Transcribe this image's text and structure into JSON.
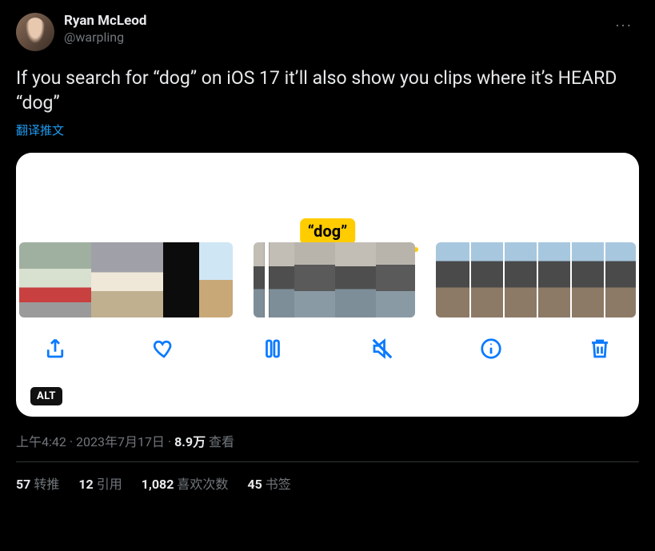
{
  "author": {
    "display_name": "Ryan McLeod",
    "handle": "@warpling"
  },
  "more_label": "···",
  "body_text": "If you search for “dog” on iOS 17 it’ll also show you clips where it’s HEARD “dog”",
  "translate_label": "翻译推文",
  "media": {
    "highlight_label": "“dog”",
    "alt_badge": "ALT",
    "controls": {
      "share": "share",
      "like": "like",
      "pause": "pause",
      "mute": "mute",
      "info": "info",
      "delete": "delete"
    }
  },
  "meta": {
    "time": "上午4:42",
    "sep1": " · ",
    "date": "2023年7月17日",
    "sep2": " · ",
    "views_count": "8.9万",
    "views_label": " 查看"
  },
  "stats": {
    "retweets": {
      "count": "57",
      "label": "转推"
    },
    "quotes": {
      "count": "12",
      "label": "引用"
    },
    "likes": {
      "count": "1,082",
      "label": "喜欢次数"
    },
    "bookmarks": {
      "count": "45",
      "label": "书签"
    }
  }
}
